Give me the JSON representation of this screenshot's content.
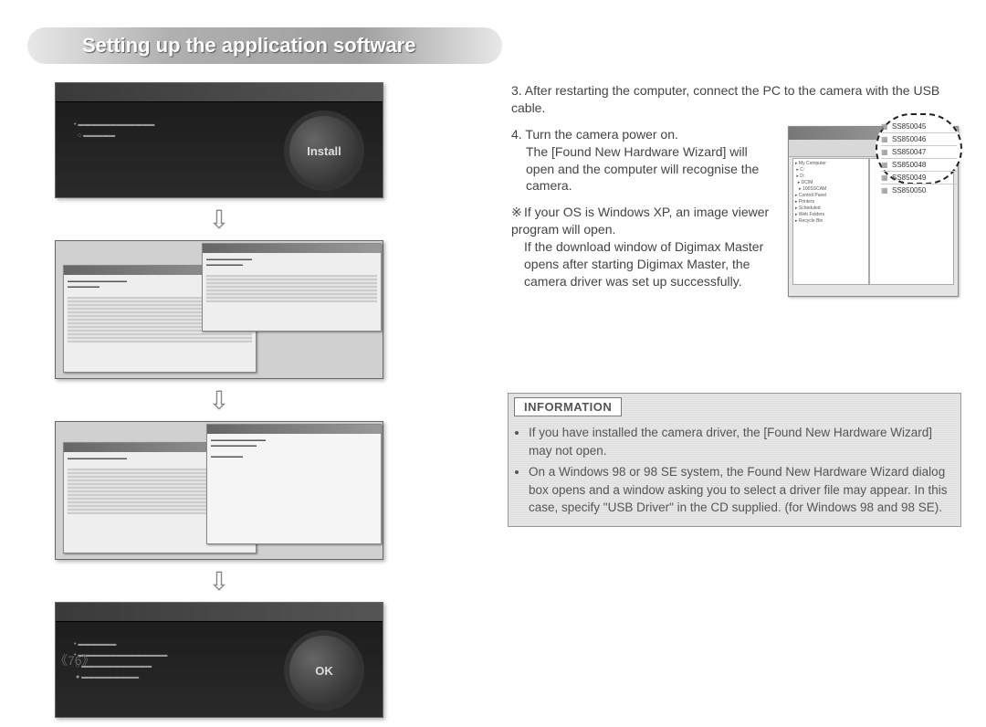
{
  "title": "Setting up the application software",
  "page_number": "《76》",
  "left_figures": {
    "fig1_button": "Install",
    "fig4_button": "OK"
  },
  "steps": {
    "s3": "3. After restarting the computer, connect the PC to the camera with the USB cable.",
    "s4a": "4. Turn the camera power on.",
    "s4b": "The [Found New Hardware Wizard] will open and the computer will recognise the camera.",
    "note_mark": "※",
    "note1": "If your OS is Windows XP, an image viewer program will open.",
    "note2": "If the download window of Digimax Master opens after starting Digimax Master, the camera driver was set up successfully."
  },
  "callout_items": [
    "SS850045",
    "SS850046",
    "SS850047",
    "SS850048",
    "SS850049",
    "SS850050"
  ],
  "info": {
    "header": "INFORMATION",
    "b1": "If you have installed the camera driver, the [Found New Hardware Wizard] may not open.",
    "b2": "On a Windows 98 or 98 SE system, the Found New Hardware Wizard dialog box opens and a window asking you to select a driver file may appear. In this case, specify \"USB Driver\" in the CD supplied. (for Windows 98 and 98 SE)."
  }
}
